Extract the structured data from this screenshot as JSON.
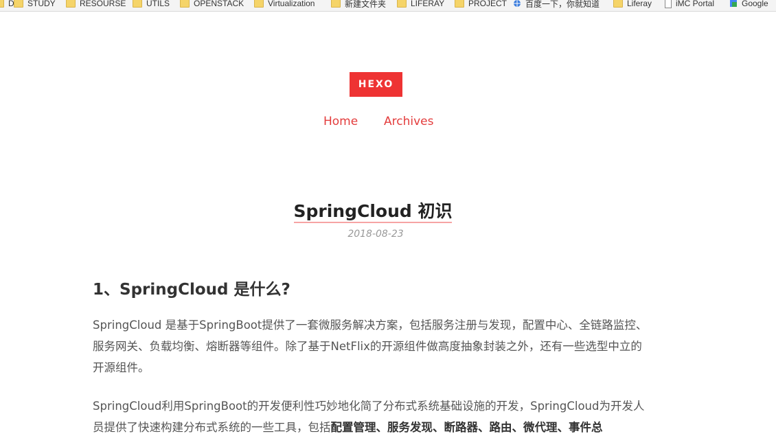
{
  "bookmarks": [
    {
      "label": "D",
      "icon": "folder-icon"
    },
    {
      "label": "STUDY",
      "icon": "folder-icon"
    },
    {
      "label": "RESOURSE",
      "icon": "folder-icon"
    },
    {
      "label": "UTILS",
      "icon": "folder-icon"
    },
    {
      "label": "OPENSTACK",
      "icon": "folder-icon"
    },
    {
      "label": "Virtualization",
      "icon": "folder-icon"
    },
    {
      "label": "新建文件夹",
      "icon": "folder-icon"
    },
    {
      "label": "LIFERAY",
      "icon": "folder-icon"
    },
    {
      "label": "PROJECT",
      "icon": "folder-icon"
    },
    {
      "label": "百度一下，你就知道",
      "icon": "globe-icon"
    },
    {
      "label": "Liferay",
      "icon": "folder-icon"
    },
    {
      "label": "iMC Portal",
      "icon": "page-icon"
    },
    {
      "label": "Google",
      "icon": "google-icon"
    }
  ],
  "site": {
    "logo": "HEXO",
    "nav": {
      "home": "Home",
      "archives": "Archives"
    },
    "accent_color": "#ee3333"
  },
  "post": {
    "title": "SpringCloud 初识",
    "date": "2018-08-23",
    "heading": "1、SpringCloud 是什么?",
    "para1": "SpringCloud 是基于SpringBoot提供了一套微服务解决方案，包括服务注册与发现，配置中心、全链路监控、服务网关、负载均衡、熔断器等组件。除了基于NetFlix的开源组件做高度抽象封装之外，还有一些选型中立的开源组件。",
    "para2_text": "SpringCloud利用SpringBoot的开发便利性巧妙地化简了分布式系统基础设施的开发，SpringCloud为开发人员提供了快速构建分布式系统的一些工具，包括",
    "para2_bold": "配置管理、服务发现、断路器、路由、微代理、事件总"
  }
}
